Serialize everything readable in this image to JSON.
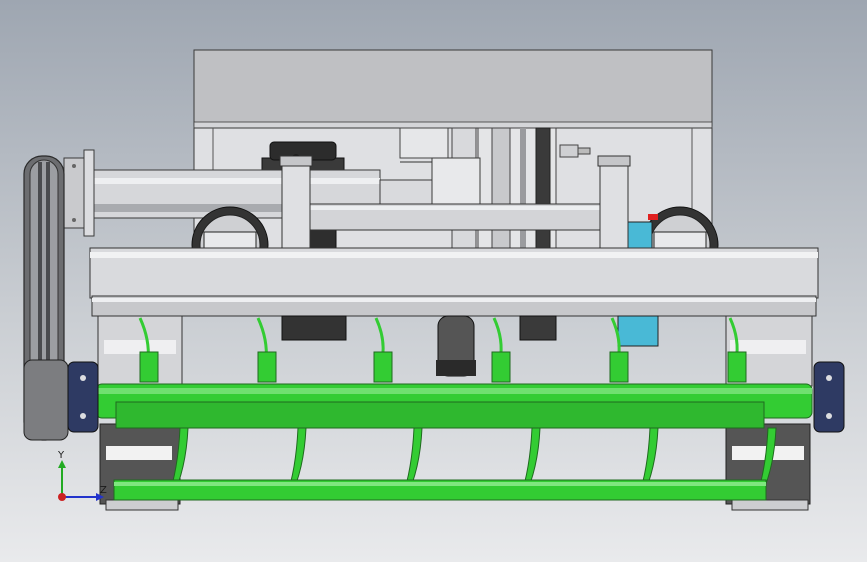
{
  "viewport": {
    "background_top": "#9ea6b1",
    "background_bottom": "#e9eaec"
  },
  "model": {
    "colors": {
      "housing_gray": "#c4c5c8",
      "steel_light": "#e3e4e6",
      "steel_mid": "#b8babd",
      "edge": "#3a3a3a",
      "green_part": "#33cc33",
      "green_dark": "#1f8a1f",
      "dark_part": "#2a2a2a",
      "cyan_part": "#49b9d6",
      "navy_bearing": "#2e3a63",
      "red_detail": "#e02020"
    },
    "tine_count": 6,
    "clamp_count": 6
  },
  "triad": {
    "x_label": "",
    "y_label": "Y",
    "z_label": "Z",
    "icon": "coordinate-triad-icon",
    "y_color": "#22aa22",
    "z_color": "#2233cc",
    "x_color": "#cc2222"
  }
}
